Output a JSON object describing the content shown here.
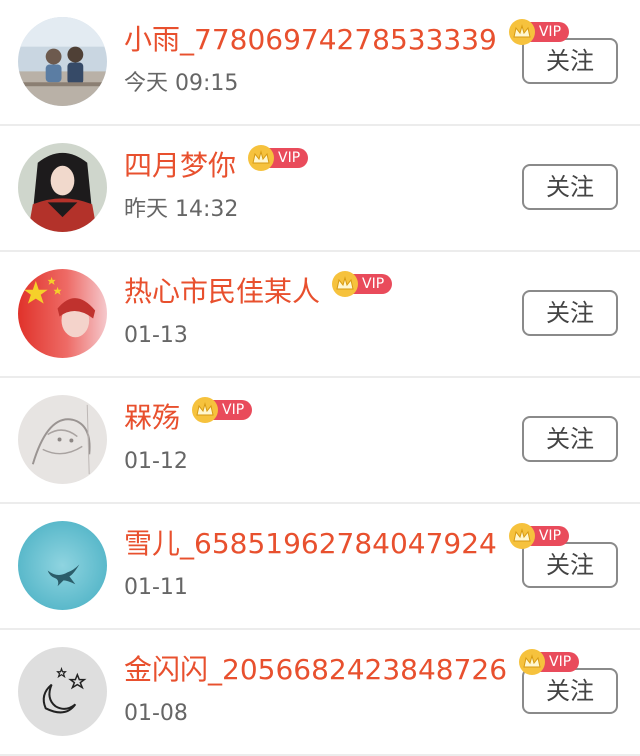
{
  "vip_label": "VIP",
  "follow_label": "关注",
  "colors": {
    "name": "#e8502e",
    "vip_badge": "#e94b5b",
    "crown": "#f6c23d",
    "time": "#666666",
    "divider": "#ececec"
  },
  "users": [
    {
      "name": "小雨_77806974278533339",
      "time": "今天 09:15",
      "vip": true,
      "avatar_icon": "two-children-photo"
    },
    {
      "name": "四月梦你",
      "time": "昨天 14:32",
      "vip": true,
      "avatar_icon": "girl-red-jacket-photo"
    },
    {
      "name": "热心市民佳某人",
      "time": "01-13",
      "vip": true,
      "avatar_icon": "red-flag-with-stars"
    },
    {
      "name": "槑殇",
      "time": "01-12",
      "vip": true,
      "avatar_icon": "sketch-drawing"
    },
    {
      "name": "雪儿_65851962784047924",
      "time": "01-11",
      "vip": true,
      "avatar_icon": "whale-tail-in-water"
    },
    {
      "name": "金闪闪_2056682423848726",
      "time": "01-08",
      "vip": true,
      "avatar_icon": "moon-and-stars-doodle"
    }
  ]
}
